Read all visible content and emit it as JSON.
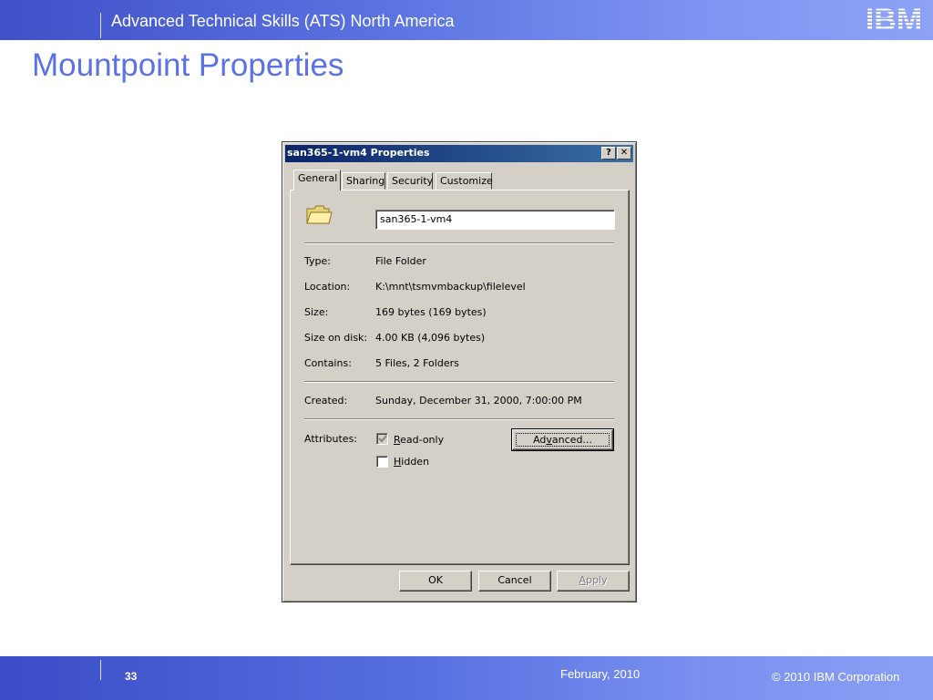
{
  "slide": {
    "header_title": "Advanced Technical Skills (ATS) North America",
    "logo_text": "IBM",
    "title": "Mountpoint Properties",
    "page_number": "33",
    "date": "February, 2010",
    "copyright": "© 2010 IBM Corporation"
  },
  "dialog": {
    "title": "san365-1-vm4 Properties",
    "help_glyph": "?",
    "close_glyph": "✕",
    "tabs": [
      {
        "label": "General",
        "active": true
      },
      {
        "label": "Sharing",
        "active": false
      },
      {
        "label": "Security",
        "active": false
      },
      {
        "label": "Customize",
        "active": false
      }
    ],
    "name_value": "san365-1-vm4",
    "properties": [
      {
        "label": "Type:",
        "value": "File Folder"
      },
      {
        "label": "Location:",
        "value": "K:\\mnt\\tsmvmbackup\\filelevel"
      },
      {
        "label": "Size:",
        "value": "169 bytes (169 bytes)"
      },
      {
        "label": "Size on disk:",
        "value": "4.00 KB (4,096 bytes)"
      },
      {
        "label": "Contains:",
        "value": "5 Files, 2 Folders"
      }
    ],
    "created": {
      "label": "Created:",
      "value": "Sunday, December 31, 2000, 7:00:00 PM"
    },
    "attributes_label": "Attributes:",
    "read_only": {
      "mnemonic": "R",
      "rest": "ead-only",
      "checked": true
    },
    "hidden": {
      "mnemonic": "H",
      "rest": "idden",
      "checked": false
    },
    "advanced_button": {
      "pre": "Ad",
      "mnemonic": "v",
      "post": "anced..."
    },
    "ok_button": "OK",
    "cancel_button": "Cancel",
    "apply_button": {
      "mnemonic": "A",
      "rest": "pply",
      "enabled": false
    }
  },
  "colors": {
    "band_blue": "#5a72e0",
    "title_blue": "#5b72e6",
    "dialog_face": "#d4d0c8",
    "titlebar_start": "#0a246a",
    "titlebar_end": "#3a6ea5"
  },
  "icons": [
    "ibm-logo",
    "folder-icon",
    "checkmark-icon",
    "help-icon",
    "close-icon"
  ]
}
